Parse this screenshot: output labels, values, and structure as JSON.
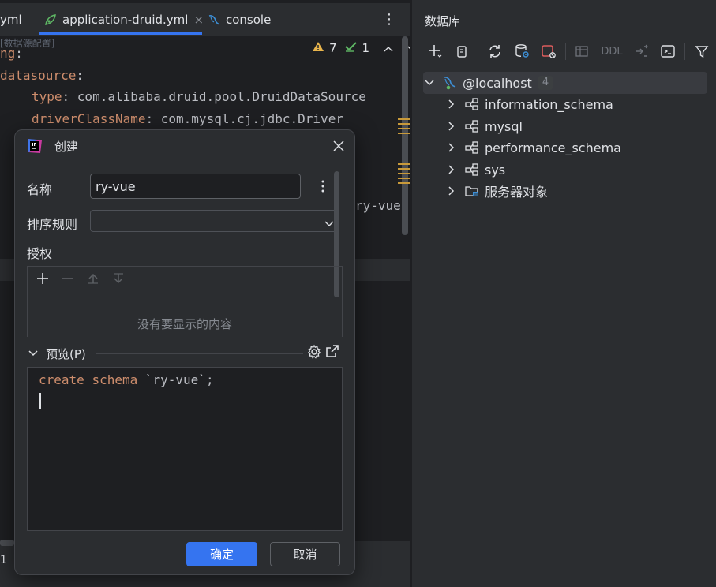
{
  "editor": {
    "tabs": [
      {
        "label": "yml"
      },
      {
        "label": "application-druid.yml",
        "close": "×"
      },
      {
        "label": "console"
      }
    ],
    "tab_menu": "⋮",
    "breadcrumb_faded": "[数据源配置]",
    "inspections": {
      "warnings": "7",
      "checks": "1"
    },
    "lines": [
      {
        "key": "ng",
        "sep": ":"
      },
      {
        "key": "datasource",
        "sep": ":"
      },
      {
        "key": "type",
        "sep": ": ",
        "value": "com.alibaba.druid.pool.DruidDataSource"
      },
      {
        "key": "driverClassName",
        "sep": ": ",
        "value": "com.mysql.cj.jdbc.Driver"
      }
    ],
    "hidden_fragment": "ry-vue?",
    "left_edge_digit": "1"
  },
  "database_panel": {
    "title": "数据库",
    "toolbar": {
      "ddl": "DDL"
    },
    "host": {
      "label": "@localhost",
      "count": "4"
    },
    "schemas": [
      {
        "label": "information_schema"
      },
      {
        "label": "mysql"
      },
      {
        "label": "performance_schema"
      },
      {
        "label": "sys"
      },
      {
        "label": "服务器对象"
      }
    ]
  },
  "dialog": {
    "title": "创建",
    "name_label": "名称",
    "name_value": "ry-vue",
    "collation_label": "排序规则",
    "collation_value": "",
    "grant_label": "授权",
    "grant_empty": "没有要显示的内容",
    "preview_label": "预览(P)",
    "preview_sql": {
      "kw1": "create",
      "kw2": "schema",
      "ident": "`ry-vue`",
      "end": ";"
    },
    "ok_label": "确定",
    "cancel_label": "取消"
  },
  "colors": {
    "accent": "#3574f0",
    "keyword": "#cf8e6d",
    "warning": "#e8b44c",
    "check": "#5fb865"
  }
}
